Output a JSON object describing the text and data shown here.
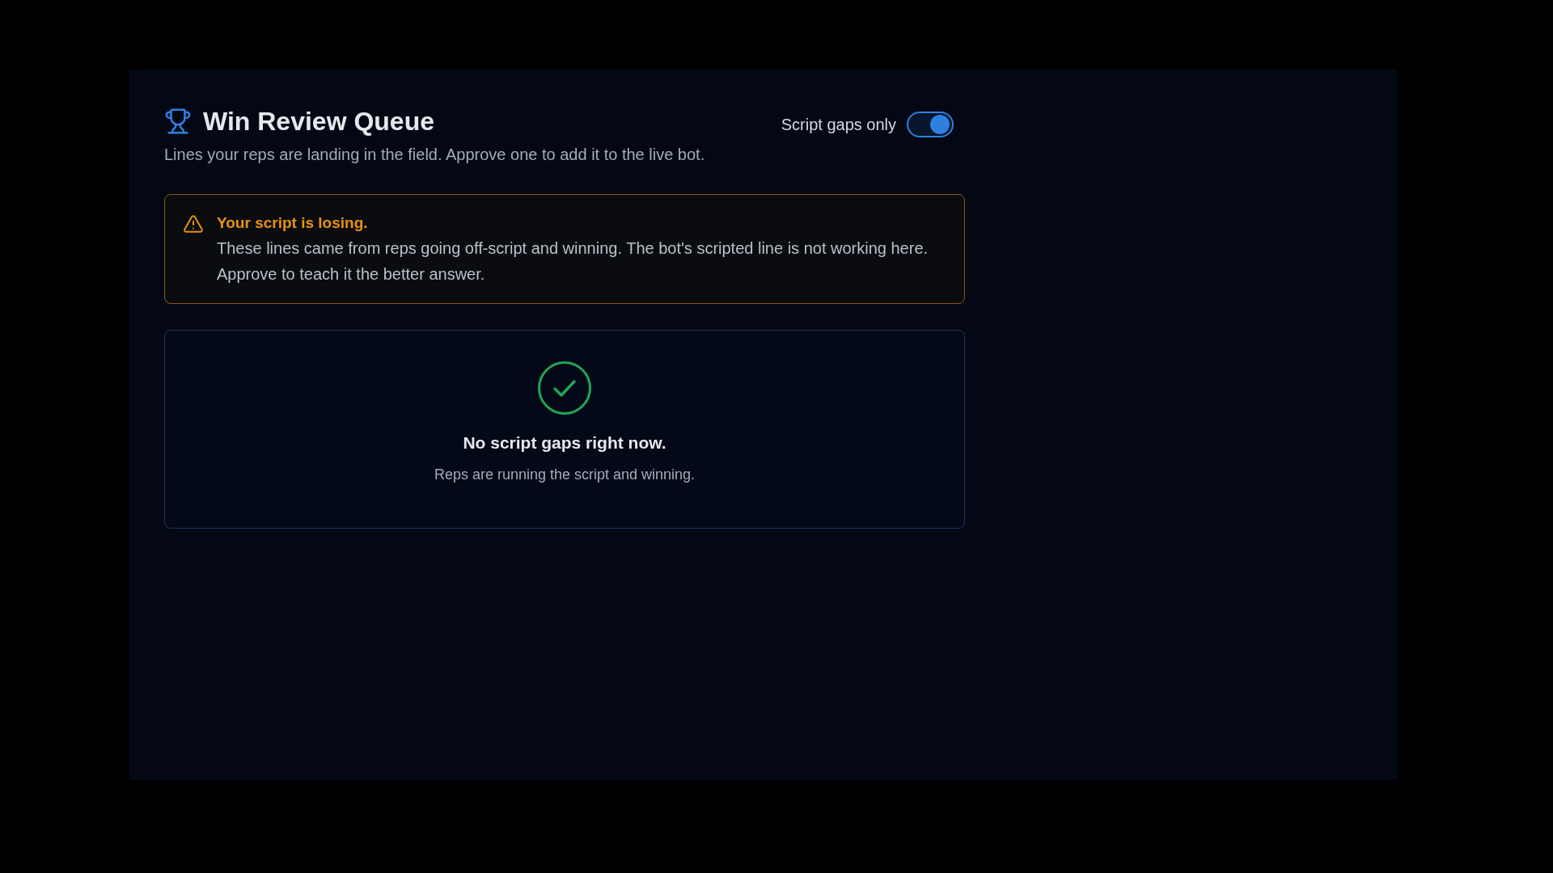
{
  "header": {
    "title": "Win Review Queue",
    "subtitle": "Lines your reps are landing in the field. Approve one to add it to the live bot.",
    "filter_toggle": {
      "label": "Script gaps only",
      "on": true
    }
  },
  "alert": {
    "kind": "warning",
    "title": "Your script is losing.",
    "message": "These lines came from reps going off-script and winning. The bot's scripted line is not working here. Approve to teach it the better answer."
  },
  "empty_state": {
    "title": "No script gaps right now.",
    "message": "Reps are running the script and winning."
  }
}
